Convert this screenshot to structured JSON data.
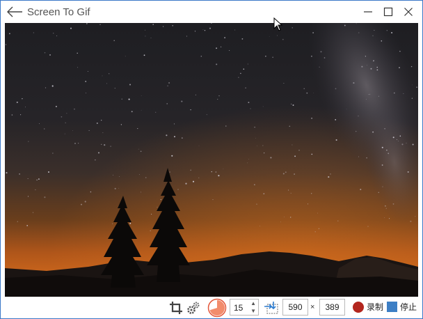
{
  "window": {
    "title": "Screen To Gif"
  },
  "titlebar": {
    "back_icon": "arrow-left-icon",
    "minimize_icon": "minimize-icon",
    "maximize_icon": "maximize-icon",
    "close_icon": "close-icon"
  },
  "capture_area": {
    "content": "starry night sky with milky way, orange horizon glow, silhouetted pine trees"
  },
  "toolbar": {
    "crop_icon": "crop-icon",
    "options_icon": "gears-icon",
    "fps_icon": "fps-pie-icon",
    "fps_value": "15",
    "size_icon": "snap-to-window-icon",
    "width": "590",
    "times": "×",
    "height": "389",
    "record_label": "录制",
    "stop_label": "停止"
  },
  "colors": {
    "accent": "#3b78c8",
    "record": "#b3261e",
    "stop": "#3d7fc5",
    "fps_icon": "#e4573a"
  }
}
